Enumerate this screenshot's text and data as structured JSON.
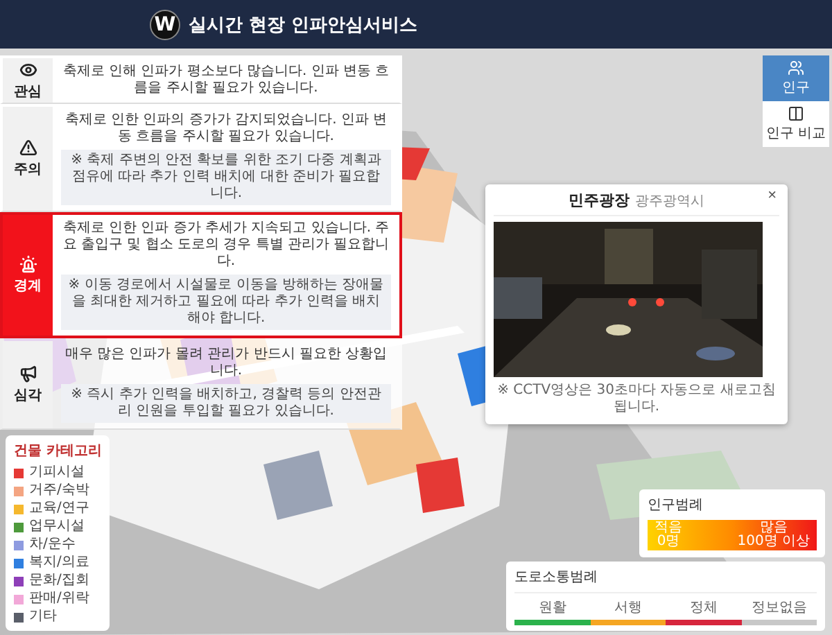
{
  "header": {
    "logo": "W",
    "title": "실시간 현장 인파안심서비스"
  },
  "alert_levels": [
    {
      "kind": "interest",
      "label": "관심",
      "selected": false,
      "message": "축제로 인해 인파가 평소보다 많습니다. 인파 변동 흐름을 주시할 필요가 있습니다."
    },
    {
      "kind": "caution",
      "label": "주의",
      "selected": false,
      "message": "축제로 인한 인파의 증가가 감지되었습니다. 인파 변동 흐름을 주시할 필요가 있습니다.",
      "note": "※ 축제 주변의 안전 확보를 위한 조기 다중 계획과 점유에 따라 추가 인력 배치에 대한 준비가 필요합니다."
    },
    {
      "kind": "alert",
      "label": "경계",
      "selected": true,
      "message": "축제로 인한 인파 증가 추세가 지속되고 있습니다. 주요 출입구 및 협소 도로의 경우 특별 관리가 필요합니다.",
      "note": "※ 이동 경로에서 시설물로 이동을 방해하는 장애물을 최대한 제거하고 필요에 따라 추가 인력을 배치해야 합니다."
    },
    {
      "kind": "serious",
      "label": "심각",
      "selected": false,
      "message": "매우 많은 인파가 몰려 관리가 반드시 필요한 상황입니다.",
      "note": "※ 즉시 추가 인력을 배치하고, 경찰력 등의 안전관리 인원을 투입할 필요가 있습니다."
    }
  ],
  "building_legend": {
    "title": "건물 카테고리",
    "items": [
      {
        "label": "기피시설",
        "color": "#e53935"
      },
      {
        "label": "거주/숙박",
        "color": "#f4a582"
      },
      {
        "label": "교육/연구",
        "color": "#f5b82e"
      },
      {
        "label": "업무시설",
        "color": "#4e9a3c"
      },
      {
        "label": "차/운수",
        "color": "#8e9be0"
      },
      {
        "label": "복지/의료",
        "color": "#2f7fe0"
      },
      {
        "label": "문화/집회",
        "color": "#8e3fb8"
      },
      {
        "label": "판매/위락",
        "color": "#f2a8d8"
      },
      {
        "label": "기타",
        "color": "#5a5f6a"
      }
    ]
  },
  "cctv_popup": {
    "title": "민주광장",
    "subtitle": "광주광역시",
    "close": "×",
    "caption": "※ CCTV영상은 30초마다 자동으로 새로고침 됩니다."
  },
  "map_buttons": [
    {
      "kind": "population",
      "label": "인구",
      "selected": true
    },
    {
      "kind": "compare",
      "label": "인구 비교",
      "selected": false
    }
  ],
  "population_legend": {
    "title": "인구범례",
    "low_label": "적음",
    "low_value": "0명",
    "high_label": "많음",
    "high_value": "100명 이상"
  },
  "road_legend": {
    "title": "도로소통범례",
    "items": [
      {
        "label": "원활",
        "color": "#2bb24c"
      },
      {
        "label": "서행",
        "color": "#f5a623"
      },
      {
        "label": "정체",
        "color": "#d7263d"
      },
      {
        "label": "정보없음",
        "color": "#c8c8c8"
      }
    ]
  }
}
